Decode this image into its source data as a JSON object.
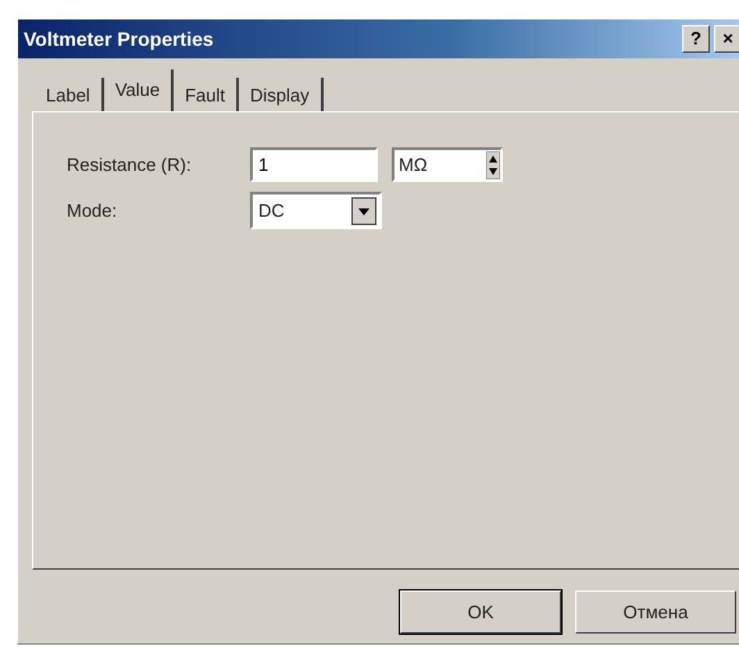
{
  "window": {
    "title": "Voltmeter Properties",
    "help_button": "?",
    "close_button": "×"
  },
  "tabs": [
    {
      "label": "Label",
      "selected": false
    },
    {
      "label": "Value",
      "selected": true
    },
    {
      "label": "Fault",
      "selected": false
    },
    {
      "label": "Display",
      "selected": false
    }
  ],
  "fields": [
    {
      "kind": "spin",
      "label": "Resistance (R):",
      "value": "1",
      "unit": "MΩ"
    },
    {
      "kind": "select",
      "label": "Mode:",
      "value": "DC"
    }
  ],
  "buttons": [
    "OK",
    "Отмена"
  ]
}
